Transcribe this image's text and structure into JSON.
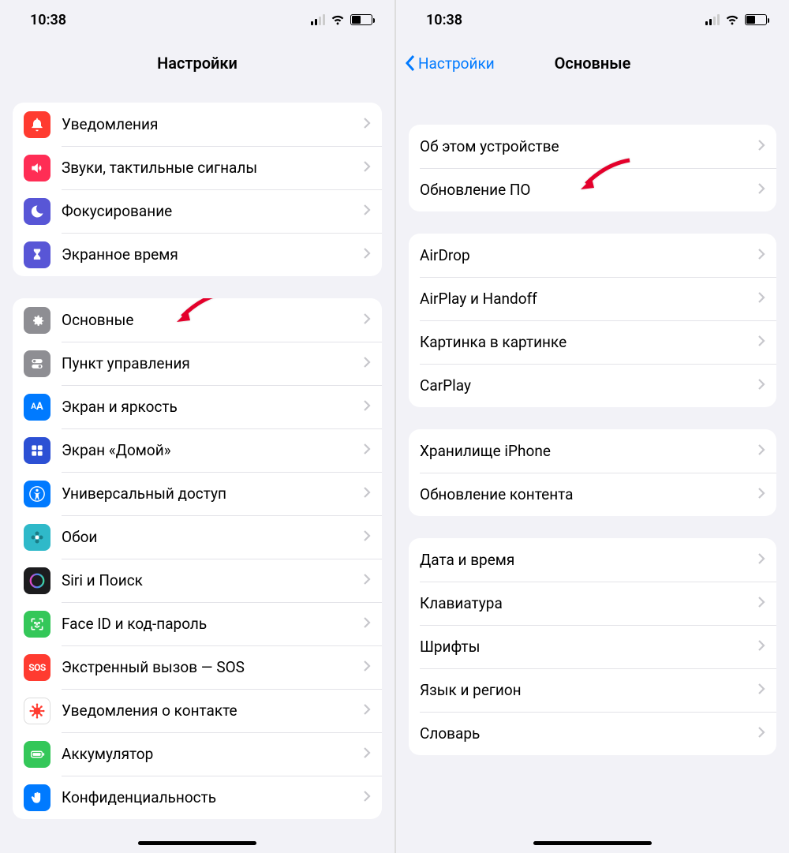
{
  "status": {
    "time": "10:38"
  },
  "left": {
    "title": "Настройки",
    "group1": [
      {
        "id": "notifications",
        "label": "Уведомления",
        "icon": "bell-icon",
        "bg": "#ff3b30"
      },
      {
        "id": "sounds",
        "label": "Звуки, тактильные сигналы",
        "icon": "speaker-icon",
        "bg": "#ff2d55"
      },
      {
        "id": "focus",
        "label": "Фокусирование",
        "icon": "moon-icon",
        "bg": "#5856d6"
      },
      {
        "id": "screentime",
        "label": "Экранное время",
        "icon": "hourglass-icon",
        "bg": "#5856d6"
      }
    ],
    "group2": [
      {
        "id": "general",
        "label": "Основные",
        "icon": "gear-icon",
        "bg": "#8e8e93"
      },
      {
        "id": "controlcenter",
        "label": "Пункт управления",
        "icon": "switches-icon",
        "bg": "#8e8e93"
      },
      {
        "id": "display",
        "label": "Экран и яркость",
        "icon": "text-size-icon",
        "bg": "#007aff",
        "text": "AA"
      },
      {
        "id": "homescreen",
        "label": "Экран «Домой»",
        "icon": "grid-icon",
        "bg": "#3355dd"
      },
      {
        "id": "accessibility",
        "label": "Универсальный доступ",
        "icon": "accessibility-icon",
        "bg": "#007aff"
      },
      {
        "id": "wallpaper",
        "label": "Обои",
        "icon": "flower-icon",
        "bg": "#33c0c0"
      },
      {
        "id": "siri",
        "label": "Siri и Поиск",
        "icon": "siri-icon",
        "bg": "#1c1c1e"
      },
      {
        "id": "faceid",
        "label": "Face ID и код-пароль",
        "icon": "faceid-icon",
        "bg": "#34c759"
      },
      {
        "id": "sos",
        "label": "Экстренный вызов — SOS",
        "icon": "sos-icon",
        "bg": "#ff3b30",
        "text": "SOS"
      },
      {
        "id": "exposure",
        "label": "Уведомления о контакте",
        "icon": "virus-icon",
        "bg": "#ffffff",
        "fg": "#ff3b30",
        "border": true
      },
      {
        "id": "battery",
        "label": "Аккумулятор",
        "icon": "battery-icon",
        "bg": "#34c759"
      },
      {
        "id": "privacy",
        "label": "Конфиденциальность",
        "icon": "hand-icon",
        "bg": "#007aff"
      }
    ]
  },
  "right": {
    "back": "Настройки",
    "title": "Основные",
    "group1": [
      {
        "id": "about",
        "label": "Об этом устройстве"
      },
      {
        "id": "update",
        "label": "Обновление ПО"
      }
    ],
    "group2": [
      {
        "id": "airdrop",
        "label": "AirDrop"
      },
      {
        "id": "airplay",
        "label": "AirPlay и Handoff"
      },
      {
        "id": "pip",
        "label": "Картинка в картинке"
      },
      {
        "id": "carplay",
        "label": "CarPlay"
      }
    ],
    "group3": [
      {
        "id": "storage",
        "label": "Хранилище iPhone"
      },
      {
        "id": "bgrefresh",
        "label": "Обновление контента"
      }
    ],
    "group4": [
      {
        "id": "datetime",
        "label": "Дата и время"
      },
      {
        "id": "keyboard",
        "label": "Клавиатура"
      },
      {
        "id": "fonts",
        "label": "Шрифты"
      },
      {
        "id": "langregion",
        "label": "Язык и регион"
      },
      {
        "id": "dictionary",
        "label": "Словарь"
      }
    ]
  }
}
